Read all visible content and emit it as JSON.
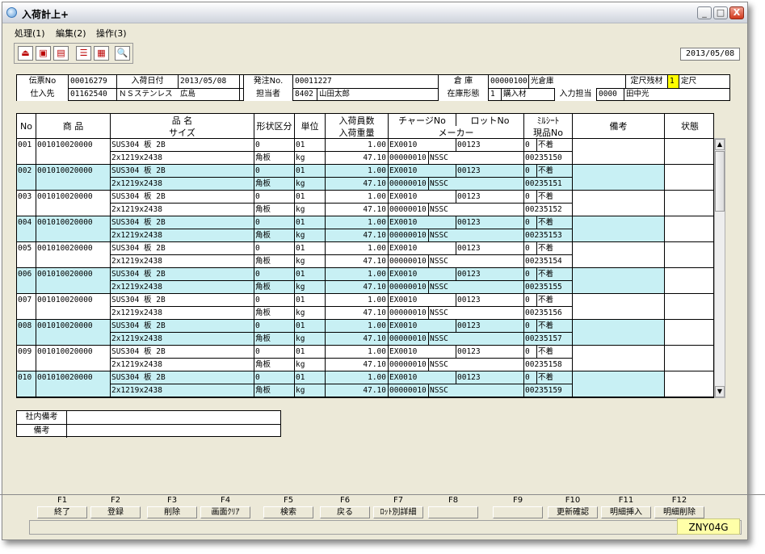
{
  "window": {
    "title": "入荷計上+",
    "min": "_",
    "max": "□",
    "close": "X"
  },
  "menu": [
    "処理(1)",
    "編集(2)",
    "操作(3)"
  ],
  "toolbar": {
    "icons": [
      "exit-icon",
      "save-icon",
      "print-icon",
      "list-icon",
      "grid-icon",
      "zoom-icon"
    ],
    "glyphs": [
      "⏏",
      "▣",
      "▤",
      "☰",
      "▦",
      "🔍"
    ]
  },
  "date": "2013/05/08",
  "header": {
    "denpyo_label": "伝票No",
    "denpyo_no": "00016279",
    "nyuka_date_label": "入荷日付",
    "nyuka_date": "2013/05/08",
    "hacchu_label": "発注No.",
    "hacchu_no": "00011227",
    "soko_label": "倉 庫",
    "soko_code": "00000100",
    "soko_name": "光倉庫",
    "teishaku_label": "定尺残材",
    "teishaku_code": "1",
    "teishaku_name": "定尺",
    "shiire_label": "仕入先",
    "shiire_code": "01162540",
    "shiire_name": "ＮＳステンレス　広島",
    "tanto_label": "担当者",
    "tanto_code": "8402",
    "tanto_name": "山田太郎",
    "zaiko_label": "在庫形態",
    "zaiko_code": "1",
    "zaiko_name": "購入材",
    "nyuryoku_label": "入力担当",
    "nyuryoku_code": "0000",
    "nyuryoku_name": "田中光"
  },
  "columns": {
    "no": "No",
    "shohin": "商 品",
    "hinmei": "品 名",
    "size": "サイズ",
    "keijo": "形状区分",
    "tani": "単位",
    "nyuka_kazu": "入荷員数",
    "nyuka_juryo": "入荷重量",
    "charge": "チャージNo",
    "lot": "ロットNo",
    "maker": "メーカー",
    "mill": "ﾐﾙｼｰﾄ",
    "genpin": "現品No",
    "biko": "備考",
    "jotai": "状態"
  },
  "rows": [
    {
      "no": "001",
      "code": "001010020000",
      "name": "SUS304 板 2B",
      "size": "2x1219x2438",
      "keijo_code": "0",
      "keijo": "角板",
      "tani_code": "01",
      "tani": "kg",
      "kazu": "1.00",
      "juryo": "47.10",
      "charge": "EX0010",
      "lot": "00123",
      "maker_code": "00000010",
      "maker": "NSSC",
      "mill_code": "0",
      "mill": "不着",
      "genpin": "00235150"
    },
    {
      "no": "002",
      "code": "001010020000",
      "name": "SUS304 板 2B",
      "size": "2x1219x2438",
      "keijo_code": "0",
      "keijo": "角板",
      "tani_code": "01",
      "tani": "kg",
      "kazu": "1.00",
      "juryo": "47.10",
      "charge": "EX0010",
      "lot": "00123",
      "maker_code": "00000010",
      "maker": "NSSC",
      "mill_code": "0",
      "mill": "不着",
      "genpin": "00235151"
    },
    {
      "no": "003",
      "code": "001010020000",
      "name": "SUS304 板 2B",
      "size": "2x1219x2438",
      "keijo_code": "0",
      "keijo": "角板",
      "tani_code": "01",
      "tani": "kg",
      "kazu": "1.00",
      "juryo": "47.10",
      "charge": "EX0010",
      "lot": "00123",
      "maker_code": "00000010",
      "maker": "NSSC",
      "mill_code": "0",
      "mill": "不着",
      "genpin": "00235152"
    },
    {
      "no": "004",
      "code": "001010020000",
      "name": "SUS304 板 2B",
      "size": "2x1219x2438",
      "keijo_code": "0",
      "keijo": "角板",
      "tani_code": "01",
      "tani": "kg",
      "kazu": "1.00",
      "juryo": "47.10",
      "charge": "EX0010",
      "lot": "00123",
      "maker_code": "00000010",
      "maker": "NSSC",
      "mill_code": "0",
      "mill": "不着",
      "genpin": "00235153"
    },
    {
      "no": "005",
      "code": "001010020000",
      "name": "SUS304 板 2B",
      "size": "2x1219x2438",
      "keijo_code": "0",
      "keijo": "角板",
      "tani_code": "01",
      "tani": "kg",
      "kazu": "1.00",
      "juryo": "47.10",
      "charge": "EX0010",
      "lot": "00123",
      "maker_code": "00000010",
      "maker": "NSSC",
      "mill_code": "0",
      "mill": "不着",
      "genpin": "00235154"
    },
    {
      "no": "006",
      "code": "001010020000",
      "name": "SUS304 板 2B",
      "size": "2x1219x2438",
      "keijo_code": "0",
      "keijo": "角板",
      "tani_code": "01",
      "tani": "kg",
      "kazu": "1.00",
      "juryo": "47.10",
      "charge": "EX0010",
      "lot": "00123",
      "maker_code": "00000010",
      "maker": "NSSC",
      "mill_code": "0",
      "mill": "不着",
      "genpin": "00235155"
    },
    {
      "no": "007",
      "code": "001010020000",
      "name": "SUS304 板 2B",
      "size": "2x1219x2438",
      "keijo_code": "0",
      "keijo": "角板",
      "tani_code": "01",
      "tani": "kg",
      "kazu": "1.00",
      "juryo": "47.10",
      "charge": "EX0010",
      "lot": "00123",
      "maker_code": "00000010",
      "maker": "NSSC",
      "mill_code": "0",
      "mill": "不着",
      "genpin": "00235156"
    },
    {
      "no": "008",
      "code": "001010020000",
      "name": "SUS304 板 2B",
      "size": "2x1219x2438",
      "keijo_code": "0",
      "keijo": "角板",
      "tani_code": "01",
      "tani": "kg",
      "kazu": "1.00",
      "juryo": "47.10",
      "charge": "EX0010",
      "lot": "00123",
      "maker_code": "00000010",
      "maker": "NSSC",
      "mill_code": "0",
      "mill": "不着",
      "genpin": "00235157"
    },
    {
      "no": "009",
      "code": "001010020000",
      "name": "SUS304 板 2B",
      "size": "2x1219x2438",
      "keijo_code": "0",
      "keijo": "角板",
      "tani_code": "01",
      "tani": "kg",
      "kazu": "1.00",
      "juryo": "47.10",
      "charge": "EX0010",
      "lot": "00123",
      "maker_code": "00000010",
      "maker": "NSSC",
      "mill_code": "0",
      "mill": "不着",
      "genpin": "00235158"
    },
    {
      "no": "010",
      "code": "001010020000",
      "name": "SUS304 板 2B",
      "size": "2x1219x2438",
      "keijo_code": "0",
      "keijo": "角板",
      "tani_code": "01",
      "tani": "kg",
      "kazu": "1.00",
      "juryo": "47.10",
      "charge": "EX0010",
      "lot": "00123",
      "maker_code": "00000010",
      "maker": "NSSC",
      "mill_code": "0",
      "mill": "不着",
      "genpin": "00235159"
    }
  ],
  "notes": {
    "shanai_label": "社内備考",
    "shanai": "",
    "biko_label": "備考",
    "biko": ""
  },
  "fkeys": [
    {
      "key": "F1",
      "label": "終了"
    },
    {
      "key": "F2",
      "label": "登録"
    },
    {
      "key": "F3",
      "label": "削除"
    },
    {
      "key": "F4",
      "label": "画面ｸﾘｱ"
    },
    {
      "key": "F5",
      "label": "検索"
    },
    {
      "key": "F6",
      "label": "戻る"
    },
    {
      "key": "F7",
      "label": "ﾛｯﾄ別詳細"
    },
    {
      "key": "F8",
      "label": ""
    },
    {
      "key": "F9",
      "label": ""
    },
    {
      "key": "F10",
      "label": "更新確認"
    },
    {
      "key": "F11",
      "label": "明細挿入"
    },
    {
      "key": "F12",
      "label": "明細削除"
    }
  ],
  "screen_id": "ZNY04G",
  "scroll": {
    "up": "▲",
    "down": "▼"
  }
}
